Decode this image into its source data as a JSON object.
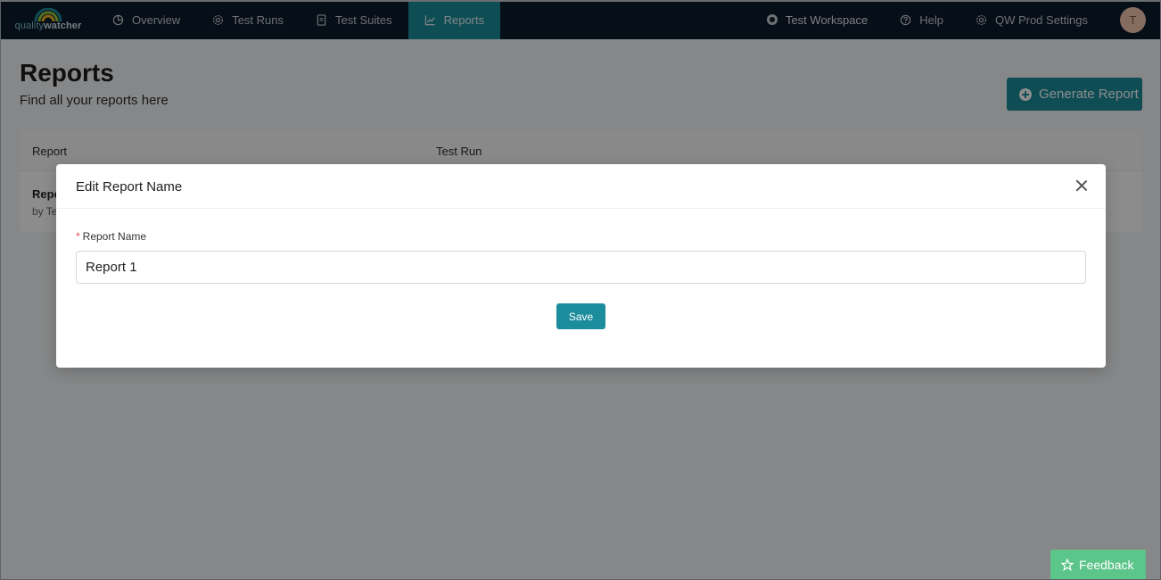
{
  "brand": {
    "logo_prefix": "quality",
    "logo_suffix": "watcher",
    "accent": "#1c8d9c"
  },
  "nav": {
    "items": [
      {
        "label": "Overview",
        "icon": "pie-chart-icon"
      },
      {
        "label": "Test Runs",
        "icon": "gear-icon"
      },
      {
        "label": "Test Suites",
        "icon": "document-icon"
      },
      {
        "label": "Reports",
        "icon": "line-chart-icon",
        "active": true
      }
    ],
    "workspace": "Test Workspace",
    "help": "Help",
    "settings": "QW Prod Settings",
    "avatar_initial": "T"
  },
  "page": {
    "title": "Reports",
    "subtitle": "Find all your reports here",
    "generate_label": "Generate Report"
  },
  "table": {
    "columns": [
      "Report",
      "Test Run"
    ],
    "rows": [
      {
        "title": "Repo",
        "subtitle": "by Te"
      }
    ]
  },
  "modal": {
    "title": "Edit Report Name",
    "field_label": "Report Name",
    "required_mark": "*",
    "field_value": "Report 1",
    "save_label": "Save"
  },
  "feedback": {
    "label": "Feedback",
    "color": "#5cc58a"
  }
}
